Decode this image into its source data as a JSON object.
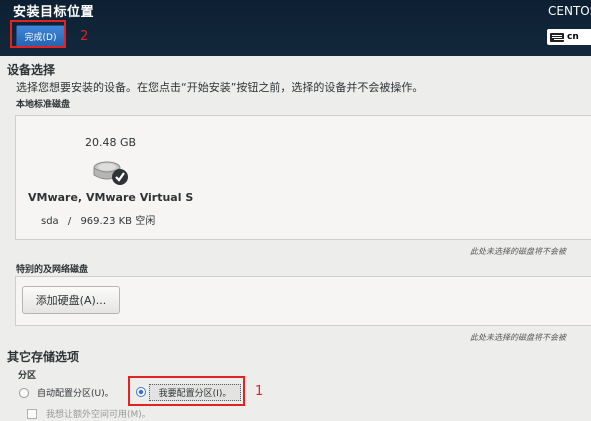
{
  "header": {
    "title": "安装目标位置",
    "product": "CENTOS",
    "done_label": "完成(D)",
    "keyboard_layout": "cn"
  },
  "annotations": {
    "done_number": "2",
    "manual_number": "1",
    "color": "#e32222"
  },
  "device_selection": {
    "title": "设备选择",
    "description": "选择您想要安装的设备。在您点击“开始安装”按钮之前，选择的设备并不会被操作。",
    "local_disks_heading": "本地标准磁盘",
    "disk": {
      "size": "20.48 GB",
      "name": "VMware, VMware Virtual S",
      "device": "sda",
      "separator": "/",
      "free": "969.23 KB 空闲",
      "selected": true
    },
    "note": "此处未选择的磁盘将不会被"
  },
  "network_disks": {
    "heading": "特别的及网络磁盘",
    "add_button_label": "添加硬盘(A)...",
    "note": "此处未选择的磁盘将不会被"
  },
  "other_options": {
    "title": "其它存储选项",
    "partition_heading": "分区",
    "auto_label": "自动配置分区(U)。",
    "manual_label": "我要配置分区(I)。",
    "selected": "manual",
    "extra_space_label": "我想让额外空间可用(M)。"
  },
  "colors": {
    "header_bg": "#0d2033",
    "accent": "#3b75c7",
    "page_bg": "#ededec"
  }
}
